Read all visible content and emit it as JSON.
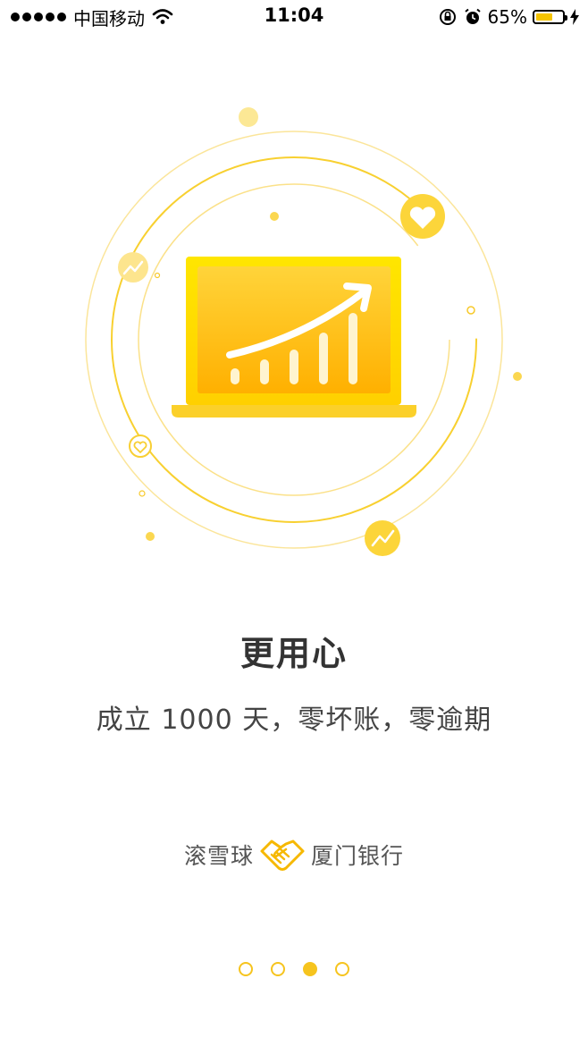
{
  "status_bar": {
    "carrier": "中国移动",
    "time": "11:04",
    "battery_percent": "65%",
    "battery_level": 0.65,
    "icons": [
      "signal-dots-icon",
      "wifi-icon",
      "rotation-lock-icon",
      "alarm-icon",
      "battery-icon",
      "charging-bolt-icon"
    ]
  },
  "onboarding": {
    "title": "更用心",
    "subtitle": "成立 1000 天，零坏账，零逾期",
    "illustration_icons": [
      "laptop-growth-chart-icon",
      "heart-badge-icon",
      "trend-badge-icon"
    ],
    "partner_left": "滚雪球",
    "partner_right": "厦门银行",
    "partner_icon": "handshake-icon",
    "pages": 4,
    "current_page": 3
  },
  "colors": {
    "accent": "#f6c41e",
    "accent_dark": "#ffb300",
    "text_primary": "#333333"
  }
}
